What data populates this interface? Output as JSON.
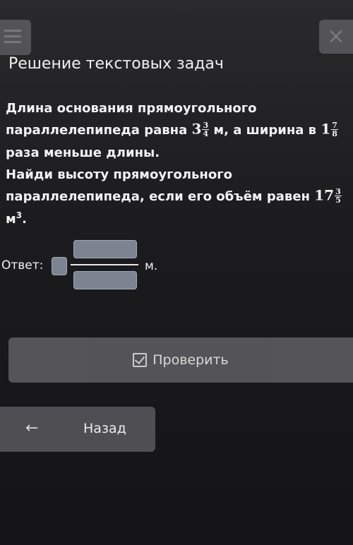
{
  "header": {
    "title": "Решение текстовых задач",
    "menu_icon": "hamburger-icon",
    "close_icon": "close-icon",
    "close_glyph": "×"
  },
  "problem": {
    "p1_part1": "Длина основания прямоугольного параллелепипеда равна",
    "p1_frac_whole": "3",
    "p1_frac_num": "3",
    "p1_frac_den": "4",
    "p1_part2": "м, а ширина в",
    "p1_frac2_whole": "1",
    "p1_frac2_num": "7",
    "p1_frac2_den": "8",
    "p1_part3": "раза меньше длины.",
    "p2_part1": "Найди высоту прямоугольного параллелепипеда, если его объём равен",
    "p2_frac_whole": "17",
    "p2_frac_num": "3",
    "p2_frac_den": "5",
    "p2_unit": "м",
    "p2_unit_power": "3",
    "p2_end": "."
  },
  "answer": {
    "label": "Ответ:",
    "whole_value": "",
    "numerator_value": "",
    "denominator_value": "",
    "unit": "м."
  },
  "buttons": {
    "check_label": "Проверить",
    "back_label": "Назад",
    "back_arrow": "←"
  },
  "colors": {
    "background": "#1f1f22",
    "input_box": "#7d8491",
    "button": "#5a5a5e"
  }
}
